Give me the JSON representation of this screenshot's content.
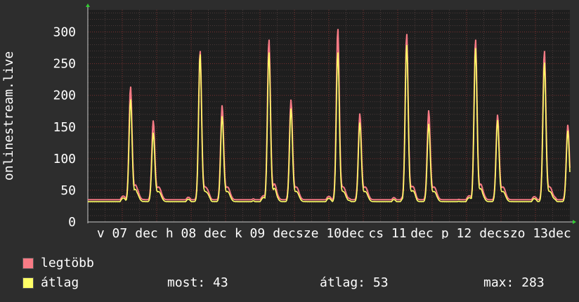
{
  "chart_data": {
    "type": "line",
    "ylabel": "onlinestream.live",
    "ylim": [
      0,
      335
    ],
    "y_ticks": [
      0,
      50,
      100,
      150,
      200,
      250,
      300
    ],
    "x_tick_labels": [
      "v 07",
      "dec",
      "h 08",
      "dec",
      "k 09",
      "dec",
      "sze 10",
      "dec",
      "cs 11",
      "dec",
      "p 12",
      "dec",
      "szo 13",
      "dec"
    ],
    "grid": true,
    "peaks": [
      {
        "day": 0.62,
        "max": 213,
        "avg": 193
      },
      {
        "day": 0.95,
        "max": 159,
        "avg": 140
      },
      {
        "day": 1.63,
        "max": 270,
        "avg": 265
      },
      {
        "day": 1.95,
        "max": 183,
        "avg": 166
      },
      {
        "day": 2.63,
        "max": 288,
        "avg": 268
      },
      {
        "day": 2.95,
        "max": 192,
        "avg": 178
      },
      {
        "day": 3.63,
        "max": 305,
        "avg": 268
      },
      {
        "day": 3.95,
        "max": 170,
        "avg": 156
      },
      {
        "day": 4.63,
        "max": 297,
        "avg": 280
      },
      {
        "day": 4.95,
        "max": 175,
        "avg": 154
      },
      {
        "day": 5.63,
        "max": 288,
        "avg": 275
      },
      {
        "day": 5.95,
        "max": 168,
        "avg": 160
      },
      {
        "day": 6.63,
        "max": 270,
        "avg": 252
      },
      {
        "day": 6.97,
        "max": 152,
        "avg": 143
      }
    ],
    "series": [
      {
        "name": "legtöbb",
        "color": "#f87b85"
      },
      {
        "name": "átlag",
        "color": "#ffff66"
      }
    ]
  },
  "legend": [
    {
      "label": "legtöbb",
      "color": "#f87b85"
    },
    {
      "label": "átlag",
      "color": "#ffff66"
    }
  ],
  "stats": {
    "now": "most: 43",
    "average": "átlag: 53",
    "max": "max: 283"
  }
}
